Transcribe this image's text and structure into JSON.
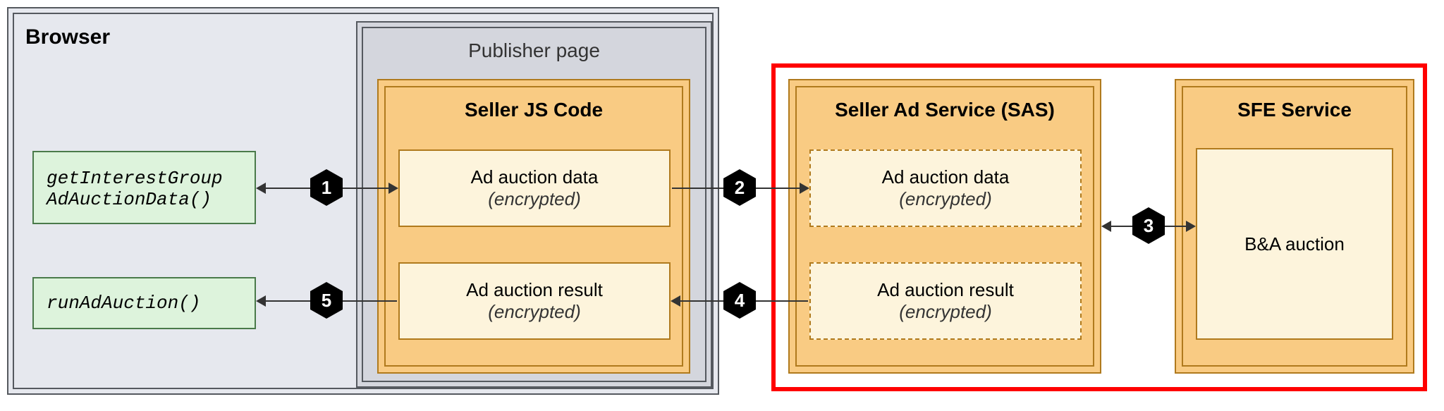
{
  "browser": {
    "title": "Browser",
    "api1": "getInterestGroup",
    "api1b": "AdAuctionData()",
    "api2": "runAdAuction()"
  },
  "publisher": {
    "title": "Publisher page",
    "sellerJs": {
      "title": "Seller JS Code",
      "adData_line1": "Ad auction data",
      "adData_line2": "(encrypted)",
      "adResult_line1": "Ad auction result",
      "adResult_line2": "(encrypted)"
    }
  },
  "sas": {
    "title": "Seller Ad Service (SAS)",
    "adData_line1": "Ad auction data",
    "adData_line2": "(encrypted)",
    "adResult_line1": "Ad auction result",
    "adResult_line2": "(encrypted)"
  },
  "sfe": {
    "title": "SFE Service",
    "auction": "B&A auction"
  },
  "steps": {
    "s1": "1",
    "s2": "2",
    "s3": "3",
    "s4": "4",
    "s5": "5"
  }
}
